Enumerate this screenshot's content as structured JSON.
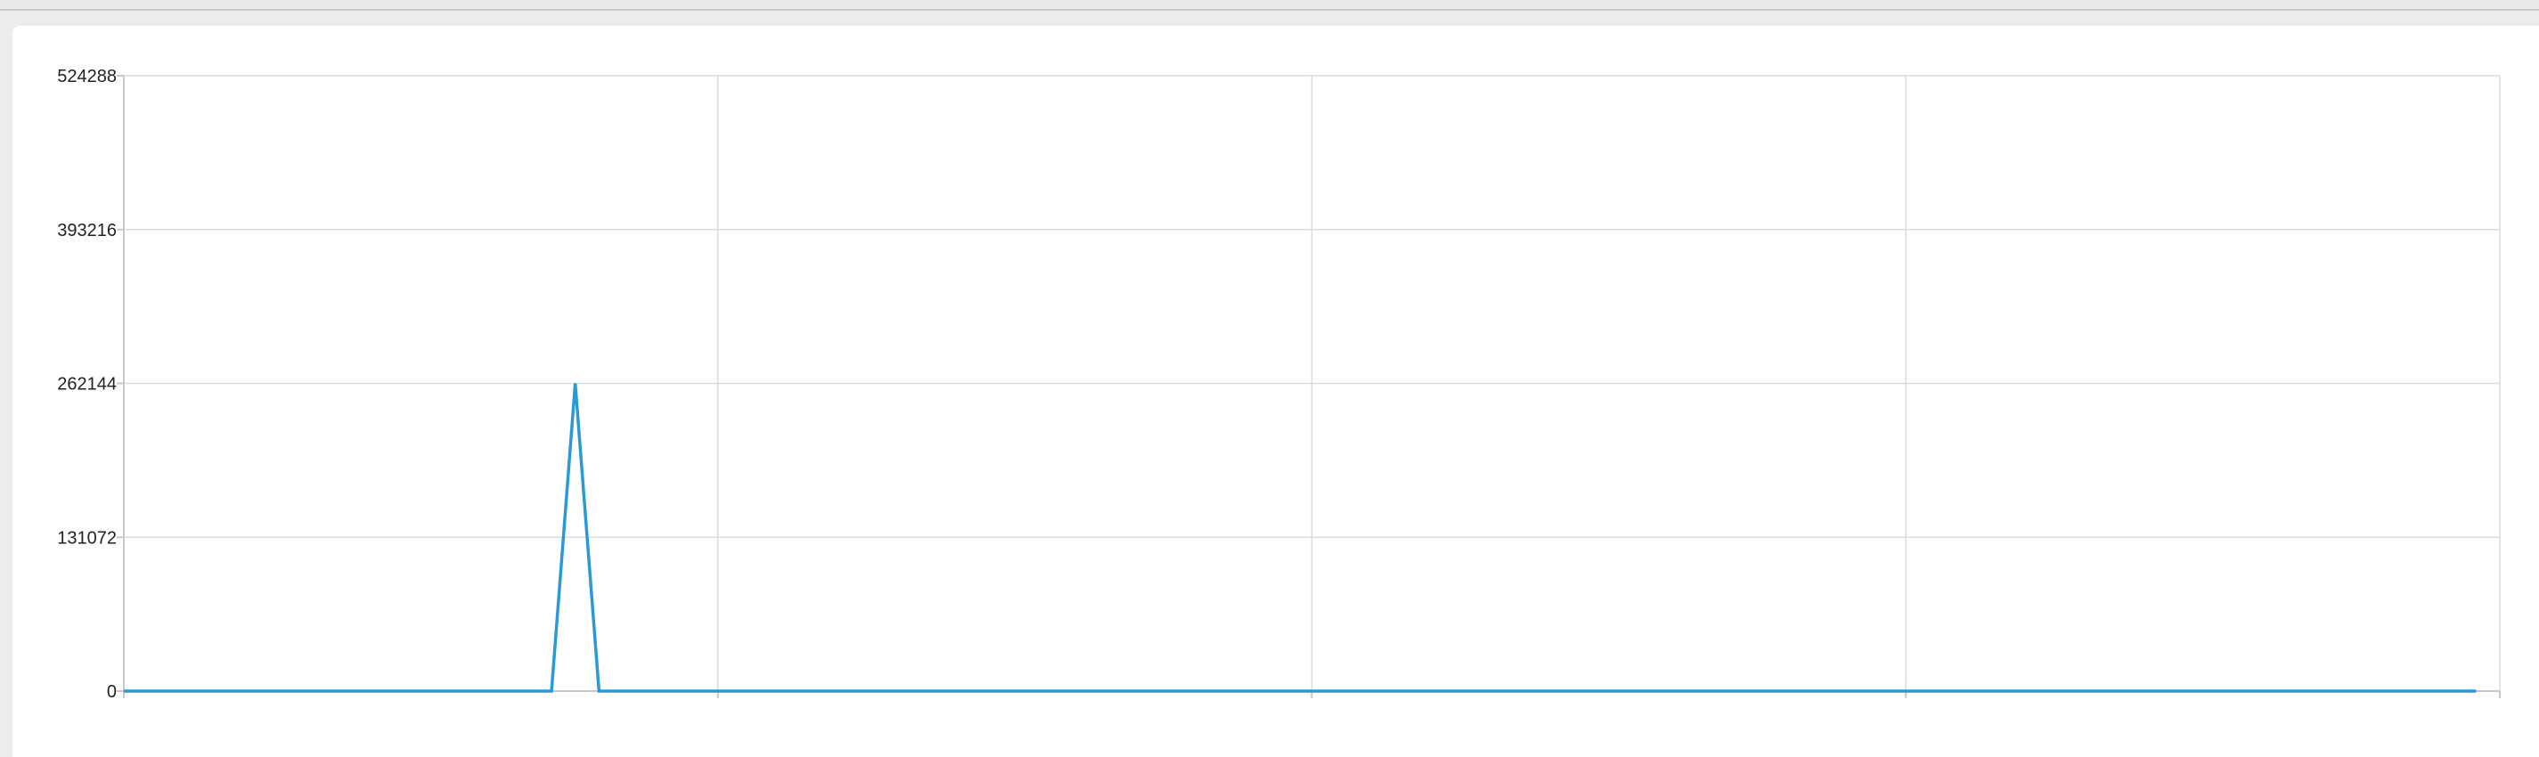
{
  "chart_data": {
    "type": "line",
    "title": "",
    "xlabel": "",
    "ylabel": "",
    "ylim": [
      0,
      524288
    ],
    "y_ticks": [
      {
        "value": 0,
        "label": "0"
      },
      {
        "value": 131072,
        "label": "131072"
      },
      {
        "value": 262144,
        "label": "262144"
      },
      {
        "value": 393216,
        "label": "393216"
      },
      {
        "value": 524288,
        "label": "524288"
      }
    ],
    "x_ticks": [
      0,
      25,
      50,
      75,
      100
    ],
    "xlim": [
      0,
      100
    ],
    "grid": true,
    "series": [
      {
        "color": "#2b9ad4",
        "x": [
          0,
          18,
          19,
          20,
          99
        ],
        "y": [
          0,
          0,
          262144,
          0,
          0
        ]
      }
    ]
  }
}
